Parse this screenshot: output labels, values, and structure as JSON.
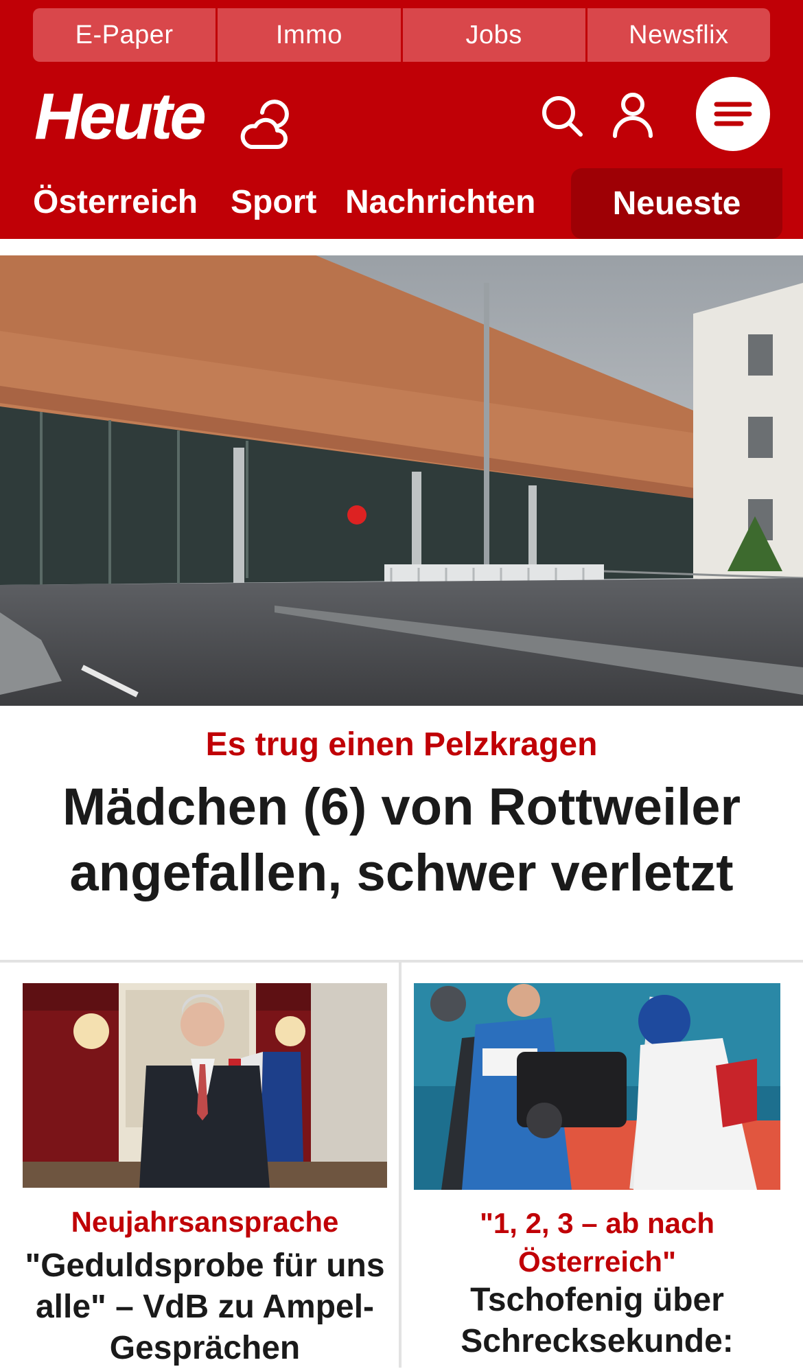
{
  "top_links": [
    {
      "label": "E-Paper"
    },
    {
      "label": "Immo"
    },
    {
      "label": "Jobs"
    },
    {
      "label": "Newsflix"
    }
  ],
  "brand": {
    "logo_text": "Heute",
    "color": "#c00006",
    "dark_color": "#9e0005"
  },
  "icons": {
    "weather": "weather-cloud-sun-icon",
    "search": "search-icon",
    "account": "user-icon",
    "menu": "hamburger-menu-icon"
  },
  "nav": {
    "items": [
      {
        "label": "Österreich"
      },
      {
        "label": "Sport"
      },
      {
        "label": "Nachrichten"
      }
    ],
    "active": {
      "label": "Neueste"
    }
  },
  "hero": {
    "image": "hospital-building-photo",
    "kicker": "Es trug einen Pelzkragen",
    "title": "Mädchen (6) von Rottweiler angefallen, schwer verletzt"
  },
  "cards": [
    {
      "image": "president-speech-photo",
      "kicker": "Neujahrsansprache",
      "title": "\"Geduldsprobe für uns alle\" – VdB zu Ampel-Gesprächen"
    },
    {
      "image": "ski-jumper-interview-photo",
      "kicker": "\"1, 2, 3 – ab nach Österreich\"",
      "title": "Tschofenig über Schrecksekunde:"
    }
  ]
}
